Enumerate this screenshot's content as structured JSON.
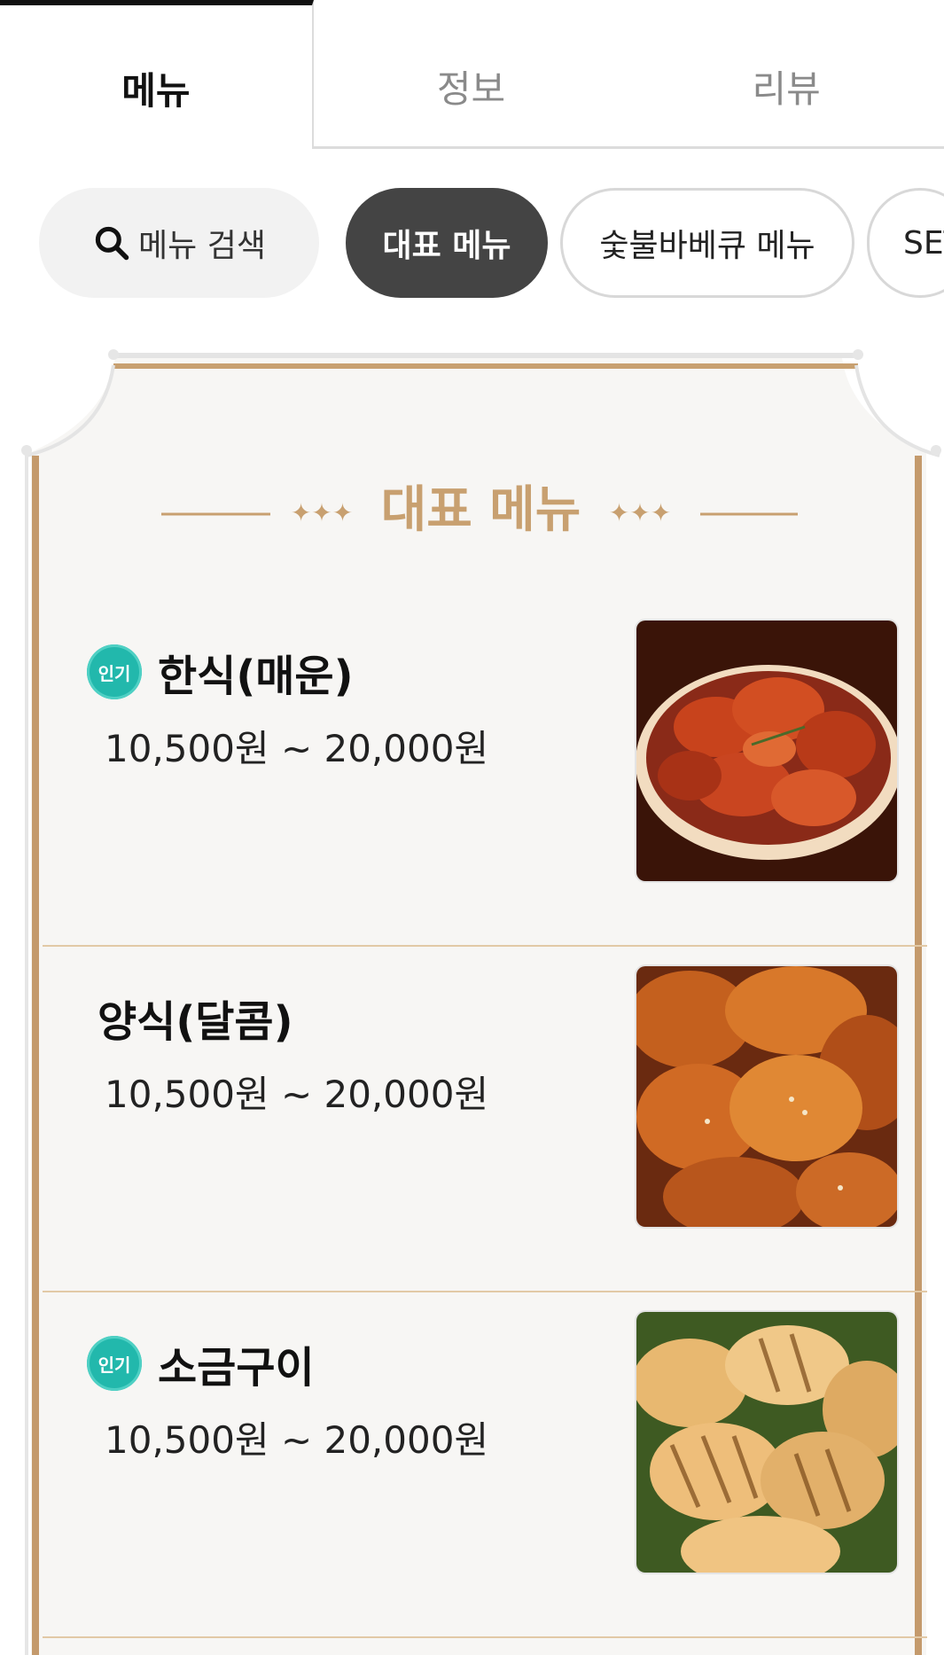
{
  "tabs": [
    {
      "label": "메뉴",
      "active": true
    },
    {
      "label": "정보",
      "active": false
    },
    {
      "label": "리뷰",
      "active": false
    }
  ],
  "filters": {
    "search_label": "메뉴 검색",
    "chips": [
      {
        "label": "대표 메뉴",
        "selected": true
      },
      {
        "label": "숯불바베큐 메뉴",
        "selected": false
      },
      {
        "label": "SET",
        "selected": false
      }
    ]
  },
  "section": {
    "title": "대표 메뉴",
    "deco_left": "✦✦✦",
    "deco_right": "✦✦✦"
  },
  "items": [
    {
      "name": "한식(매운)",
      "price": "10,500원 ~ 20,000원",
      "badge": "인기",
      "image": "spicy-chicken"
    },
    {
      "name": "양식(달콤)",
      "price": "10,500원 ~ 20,000원",
      "badge": "",
      "image": "sweet-chicken"
    },
    {
      "name": "소금구이",
      "price": "10,500원 ~ 20,000원",
      "badge": "인기",
      "image": "grilled-chicken"
    }
  ],
  "colors": {
    "accent_gold": "#c8a070",
    "frame_brown": "#c49a6c",
    "badge_teal": "#22b8ac",
    "chip_selected": "#444444"
  }
}
